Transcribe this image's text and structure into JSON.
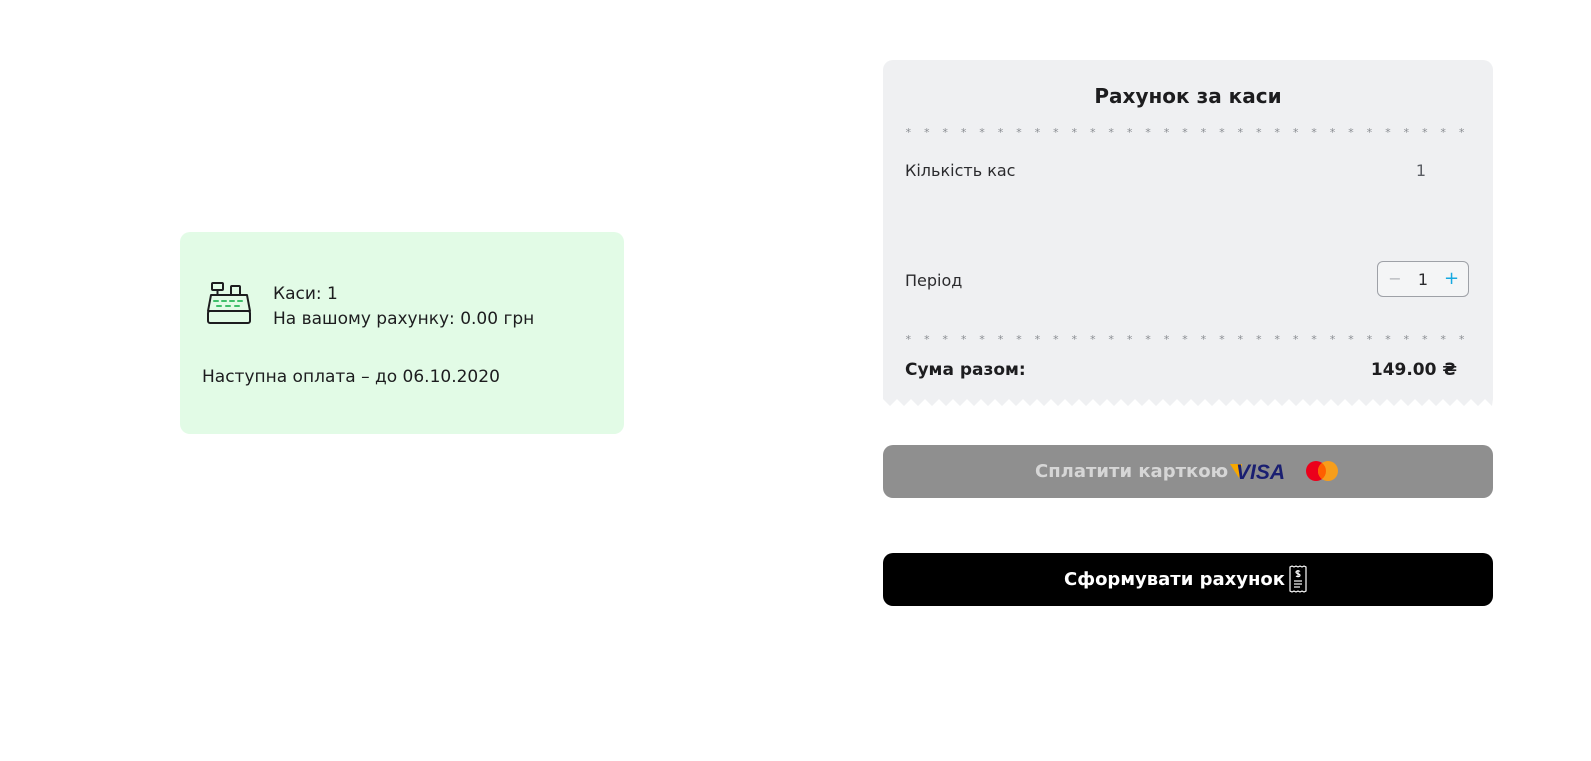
{
  "info_card": {
    "registers_line": "Каси: 1",
    "balance_line": "На вашому рахунку: 0.00 грн",
    "next_payment": "Наступна оплата – до 06.10.2020",
    "icon": "cash-register-icon",
    "background": "#e2fbe6"
  },
  "receipt": {
    "title": "Рахунок за каси",
    "dots": "* * * * * * * * * * * * * * * * * * * * * * * * * * * * * * * * * * * * * * * * * * * * * * * * * * * * * *",
    "quantity_label": "Кількість кас",
    "quantity_value": "1",
    "period_label": "Період",
    "period_stepper": {
      "minus": "−",
      "value": "1",
      "plus": "+"
    },
    "total_label": "Сума разом:",
    "total_value": "149.00 ₴",
    "background": "#eff0f2"
  },
  "pay_button": {
    "label": "Сплатити карткою",
    "logos": [
      "VISA",
      "Mastercard"
    ],
    "visa_text": "VISA",
    "state": "disabled",
    "background": "#8f8f8f"
  },
  "invoice_button": {
    "label": "Сформувати рахунок",
    "icon": "invoice-receipt-icon",
    "background": "#000000"
  },
  "colors": {
    "accent_plus": "#16a9e0",
    "mc_red": "#eb001b",
    "mc_orange": "#f79e1b",
    "visa_blue": "#1a1f71",
    "visa_gold": "#f7a800"
  }
}
